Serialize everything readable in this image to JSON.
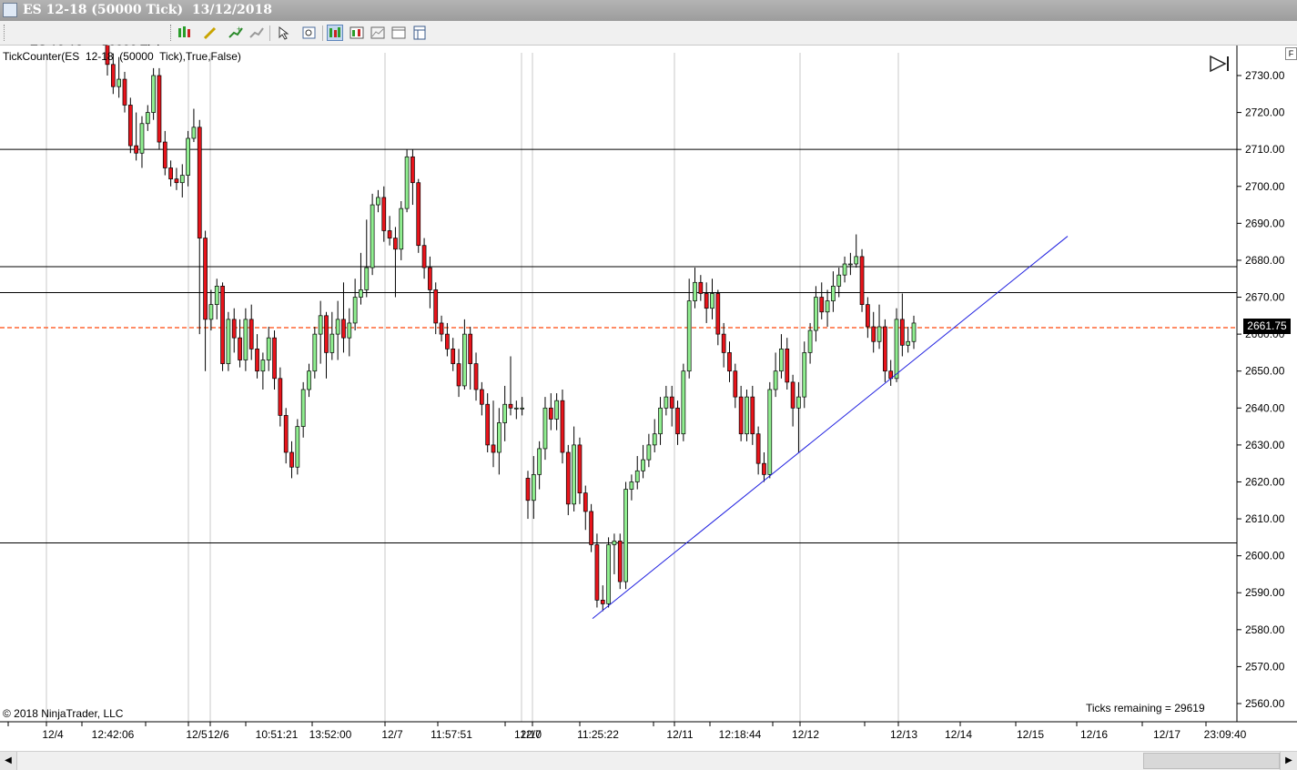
{
  "window": {
    "title": "ES 12-18 (50000 Tick)  13/12/2018"
  },
  "toolbar": {
    "instrument": "ES 12-18",
    "period": "50000 Tick",
    "icons": [
      "bar-style-icon",
      "drawing-tool-icon",
      "add-indicator-icon",
      "strategy-icon",
      "cursor-icon",
      "zoom-icon",
      "data-box-icon",
      "chart-trader-icon",
      "properties-icon",
      "window-icon"
    ]
  },
  "chart": {
    "indicator_label": "TickCounter(ES  12-18  (50000  Tick),True,False)",
    "copyright": "© 2018 NinjaTrader, LLC",
    "ticks_remaining": "Ticks remaining = 29619",
    "last_price": "2661.75",
    "colors": {
      "up": "#90ee90",
      "down": "#e8141b",
      "trendline": "#2020e0",
      "last_price_line": "#ff6633"
    }
  },
  "chart_data": {
    "type": "candlestick",
    "y_axis": {
      "min": 2556,
      "max": 2735,
      "ticks": [
        "2730.00",
        "2720.00",
        "2710.00",
        "2700.00",
        "2690.00",
        "2680.00",
        "2670.00",
        "2660.00",
        "2650.00",
        "2640.00",
        "2630.00",
        "2620.00",
        "2610.00",
        "2600.00",
        "2590.00",
        "2580.00",
        "2570.00",
        "2560.00"
      ]
    },
    "x_axis_labels": [
      "12/4",
      "12:42:06",
      "12/5",
      "12/6",
      "10:51:21",
      "13:52:00",
      "12/7",
      "11:57:51",
      "12/10",
      "11:25:22",
      "12/11",
      "12:18:44",
      "12/12",
      "12/13",
      "12/14",
      "12/15",
      "12/16",
      "12/17",
      "23:09:40"
    ],
    "horizontal_lines": [
      2710,
      2678.25,
      2671.25,
      2603.5
    ],
    "last_price": 2661.75,
    "trendline": {
      "from": [
        0,
        2583
      ],
      "to": [
        1,
        2686.5
      ]
    },
    "candles": [
      [
        2740,
        2733,
        2742,
        2730
      ],
      [
        2733,
        2727,
        2736,
        2725
      ],
      [
        2727,
        2729,
        2735,
        2724
      ],
      [
        2729,
        2722,
        2731,
        2720
      ],
      [
        2722,
        2711,
        2724,
        2709
      ],
      [
        2711,
        2709,
        2720,
        2707
      ],
      [
        2709,
        2717,
        2719,
        2705
      ],
      [
        2717,
        2720,
        2722,
        2715
      ],
      [
        2720,
        2730,
        2732,
        2718
      ],
      [
        2730,
        2712,
        2732,
        2710
      ],
      [
        2712,
        2705,
        2715,
        2703
      ],
      [
        2705,
        2702,
        2707,
        2700
      ],
      [
        2702,
        2701,
        2705,
        2699
      ],
      [
        2701,
        2703,
        2706,
        2697
      ],
      [
        2703,
        2713,
        2715,
        2700
      ],
      [
        2713,
        2716,
        2721,
        2712
      ],
      [
        2716,
        2686,
        2718,
        2660
      ],
      [
        2686,
        2664,
        2688,
        2650
      ],
      [
        2664,
        2668,
        2672,
        2661
      ],
      [
        2668,
        2673,
        2675,
        2664
      ],
      [
        2673,
        2652,
        2674,
        2650
      ],
      [
        2652,
        2664,
        2666,
        2650
      ],
      [
        2664,
        2659,
        2667,
        2655
      ],
      [
        2659,
        2653,
        2664,
        2651
      ],
      [
        2653,
        2664,
        2667,
        2650
      ],
      [
        2664,
        2656,
        2668,
        2653
      ],
      [
        2656,
        2650,
        2660,
        2648
      ],
      [
        2650,
        2653,
        2655,
        2645
      ],
      [
        2653,
        2659,
        2662,
        2650
      ],
      [
        2659,
        2648,
        2661,
        2645
      ],
      [
        2648,
        2638,
        2651,
        2635
      ],
      [
        2638,
        2628,
        2640,
        2625
      ],
      [
        2628,
        2624,
        2631,
        2621
      ],
      [
        2624,
        2635,
        2637,
        2622
      ],
      [
        2635,
        2645,
        2647,
        2632
      ],
      [
        2645,
        2650,
        2652,
        2643
      ],
      [
        2650,
        2660,
        2662,
        2648
      ],
      [
        2660,
        2665,
        2669,
        2652
      ],
      [
        2665,
        2655,
        2666,
        2648
      ],
      [
        2655,
        2660,
        2666,
        2653
      ],
      [
        2660,
        2664,
        2669,
        2653
      ],
      [
        2664,
        2659,
        2674,
        2655
      ],
      [
        2659,
        2663,
        2667,
        2654
      ],
      [
        2663,
        2670,
        2675,
        2661
      ],
      [
        2670,
        2672,
        2682,
        2668
      ],
      [
        2672,
        2678,
        2691,
        2670
      ],
      [
        2678,
        2695,
        2698,
        2676
      ],
      [
        2695,
        2697,
        2699,
        2693
      ],
      [
        2697,
        2688,
        2700,
        2685
      ],
      [
        2688,
        2686,
        2692,
        2684
      ],
      [
        2686,
        2683,
        2689,
        2670
      ],
      [
        2683,
        2694,
        2696,
        2680
      ],
      [
        2694,
        2708,
        2710,
        2693
      ],
      [
        2708,
        2701,
        2710,
        2695
      ],
      [
        2701,
        2684,
        2702,
        2682
      ],
      [
        2684,
        2678,
        2686,
        2675
      ],
      [
        2678,
        2672,
        2681,
        2667
      ],
      [
        2672,
        2663,
        2674,
        2660
      ],
      [
        2663,
        2660,
        2665,
        2658
      ],
      [
        2660,
        2656,
        2663,
        2654
      ],
      [
        2656,
        2652,
        2659,
        2650
      ],
      [
        2652,
        2646,
        2656,
        2643
      ],
      [
        2646,
        2660,
        2664,
        2645
      ],
      [
        2660,
        2652,
        2662,
        2645
      ],
      [
        2652,
        2645,
        2655,
        2642
      ],
      [
        2645,
        2641,
        2647,
        2638
      ],
      [
        2641,
        2630,
        2644,
        2628
      ],
      [
        2630,
        2628,
        2642,
        2624
      ],
      [
        2628,
        2636,
        2640,
        2622
      ],
      [
        2636,
        2641,
        2646,
        2631
      ],
      [
        2641,
        2640,
        2654,
        2638
      ],
      [
        2640,
        2640,
        2642,
        2637
      ],
      [
        2640,
        2640,
        2643,
        2638
      ],
      [
        2621,
        2615,
        2623,
        2610
      ],
      [
        2615,
        2622,
        2627,
        2610
      ],
      [
        2622,
        2629,
        2631,
        2618
      ],
      [
        2629,
        2640,
        2643,
        2626
      ],
      [
        2640,
        2637,
        2644,
        2634
      ],
      [
        2637,
        2642,
        2644,
        2634
      ],
      [
        2642,
        2628,
        2645,
        2625
      ],
      [
        2628,
        2614,
        2630,
        2611
      ],
      [
        2614,
        2630,
        2635,
        2612
      ],
      [
        2630,
        2617,
        2632,
        2614
      ],
      [
        2617,
        2612,
        2619,
        2607
      ],
      [
        2612,
        2603,
        2614,
        2601
      ],
      [
        2603,
        2588,
        2606,
        2586
      ],
      [
        2588,
        2587,
        2592,
        2585
      ],
      [
        2587,
        2603,
        2605,
        2586
      ],
      [
        2603,
        2604,
        2606,
        2595
      ],
      [
        2604,
        2593,
        2606,
        2591
      ],
      [
        2593,
        2618,
        2620,
        2591
      ],
      [
        2618,
        2620,
        2622,
        2615
      ],
      [
        2620,
        2623,
        2627,
        2618
      ],
      [
        2623,
        2626,
        2630,
        2621
      ],
      [
        2626,
        2630,
        2633,
        2624
      ],
      [
        2630,
        2633,
        2637,
        2628
      ],
      [
        2633,
        2640,
        2643,
        2630
      ],
      [
        2640,
        2643,
        2646,
        2638
      ],
      [
        2643,
        2640,
        2646,
        2635
      ],
      [
        2640,
        2633,
        2642,
        2630
      ],
      [
        2633,
        2650,
        2652,
        2631
      ],
      [
        2650,
        2669,
        2675,
        2648
      ],
      [
        2669,
        2674,
        2678,
        2667
      ],
      [
        2674,
        2671,
        2676,
        2669
      ],
      [
        2671,
        2667,
        2674,
        2663
      ],
      [
        2667,
        2671,
        2675,
        2664
      ],
      [
        2671,
        2660,
        2672,
        2657
      ],
      [
        2660,
        2655,
        2663,
        2651
      ],
      [
        2655,
        2650,
        2658,
        2647
      ],
      [
        2650,
        2643,
        2652,
        2640
      ],
      [
        2643,
        2633,
        2646,
        2631
      ],
      [
        2633,
        2643,
        2645,
        2631
      ],
      [
        2643,
        2633,
        2646,
        2630
      ],
      [
        2633,
        2625,
        2635,
        2622
      ],
      [
        2625,
        2622,
        2628,
        2620
      ],
      [
        2622,
        2645,
        2647,
        2621
      ],
      [
        2645,
        2650,
        2655,
        2643
      ],
      [
        2650,
        2656,
        2660,
        2648
      ],
      [
        2656,
        2647,
        2659,
        2645
      ],
      [
        2647,
        2640,
        2649,
        2635
      ],
      [
        2640,
        2643,
        2647,
        2628
      ],
      [
        2643,
        2655,
        2658,
        2640
      ],
      [
        2655,
        2661,
        2663,
        2652
      ],
      [
        2661,
        2670,
        2673,
        2658
      ],
      [
        2670,
        2666,
        2674,
        2664
      ],
      [
        2666,
        2669,
        2672,
        2662
      ],
      [
        2669,
        2673,
        2677,
        2666
      ],
      [
        2673,
        2676,
        2678,
        2670
      ],
      [
        2676,
        2679,
        2681,
        2674
      ],
      [
        2679,
        2679,
        2682,
        2676
      ],
      [
        2679,
        2681,
        2687,
        2678
      ],
      [
        2681,
        2668,
        2683,
        2666
      ],
      [
        2668,
        2662,
        2670,
        2659
      ],
      [
        2662,
        2658,
        2666,
        2655
      ],
      [
        2658,
        2662,
        2668,
        2656
      ],
      [
        2662,
        2650,
        2664,
        2647
      ],
      [
        2650,
        2648,
        2653,
        2646
      ],
      [
        2648,
        2664,
        2667,
        2647
      ],
      [
        2664,
        2657,
        2671,
        2654
      ],
      [
        2657,
        2658,
        2662,
        2655
      ],
      [
        2658,
        2663,
        2665,
        2656
      ]
    ]
  }
}
